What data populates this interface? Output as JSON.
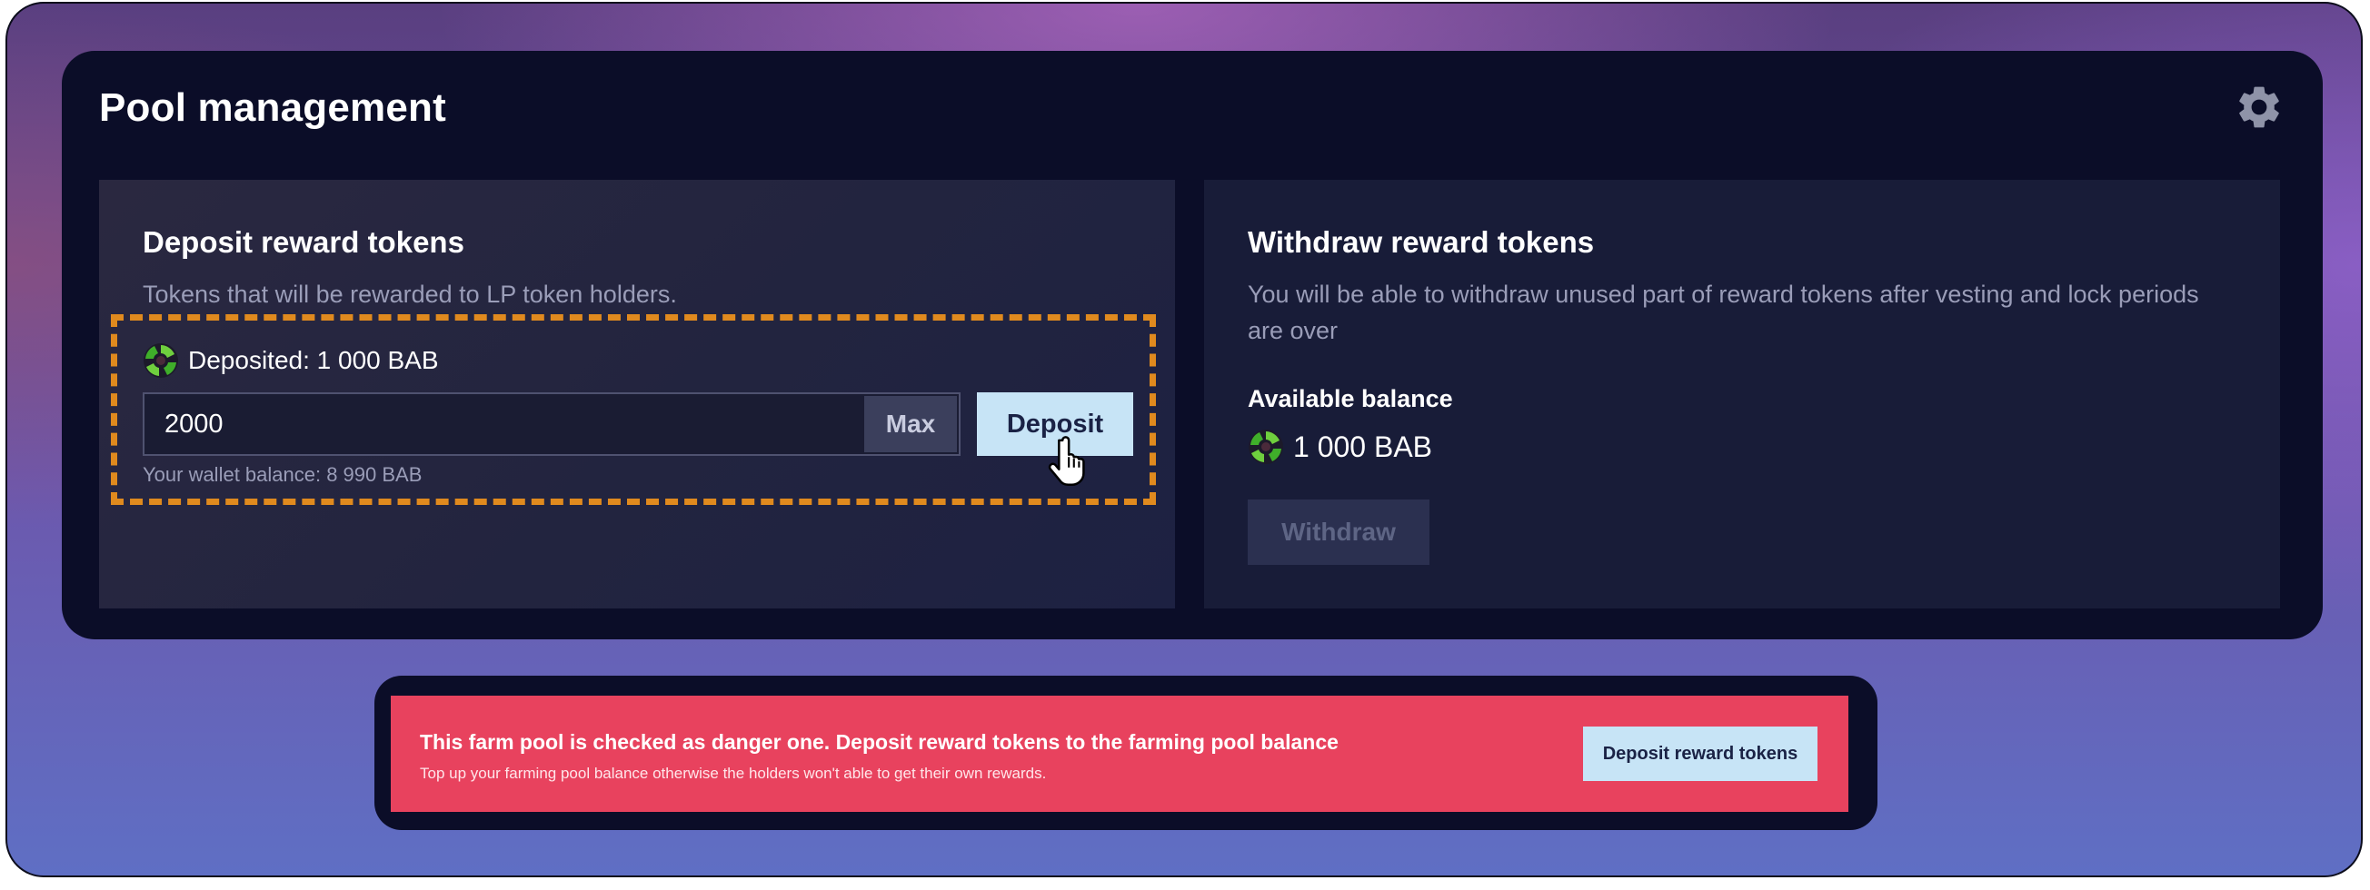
{
  "header": {
    "title": "Pool management",
    "settings_icon": "gear-icon"
  },
  "deposit": {
    "title": "Deposit reward tokens",
    "description": "Tokens that will be rewarded to LP token holders.",
    "deposited_label": "Deposited: 1 000 BAB",
    "token_icon": "bab-token-icon",
    "input_value": "2000",
    "max_label": "Max",
    "deposit_label": "Deposit",
    "wallet_balance": "Your wallet balance: 8 990 BAB",
    "highlight_color": "#e08a1e"
  },
  "withdraw": {
    "title": "Withdraw reward tokens",
    "description": "You will be able to withdraw unused part of reward tokens after vesting and lock periods are over",
    "available_label": "Available balance",
    "available_amount": "1 000 BAB",
    "token_icon": "bab-token-icon",
    "withdraw_label": "Withdraw"
  },
  "alert": {
    "title": "This farm pool is checked as danger one. Deposit reward tokens to the farming pool balance",
    "subtitle": "Top up your farming pool balance otherwise the holders won't able to get their own rewards.",
    "button_label": "Deposit reward tokens",
    "color": "#e8425e"
  },
  "colors": {
    "panel": "#0b0d28",
    "accent_button": "#c7e4f6"
  }
}
